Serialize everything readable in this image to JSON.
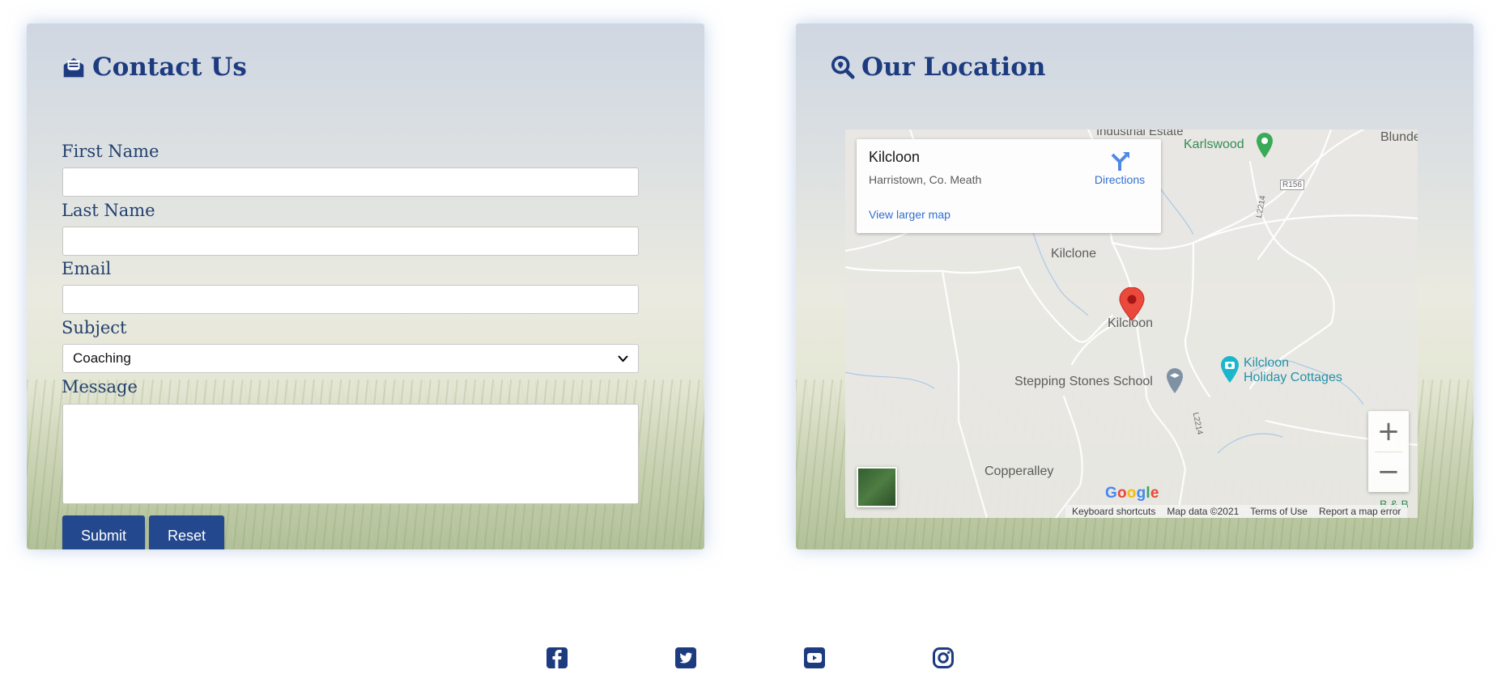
{
  "contact": {
    "title": "Contact Us",
    "title_icon": "envelope-open-text-icon",
    "fields": {
      "first_name": {
        "label": "First Name",
        "value": ""
      },
      "last_name": {
        "label": "Last Name",
        "value": ""
      },
      "email": {
        "label": "Email",
        "value": ""
      },
      "subject": {
        "label": "Subject",
        "value": "Coaching"
      },
      "message": {
        "label": "Message",
        "value": ""
      }
    },
    "buttons": {
      "submit": "Submit",
      "reset": "Reset"
    }
  },
  "location": {
    "title": "Our Location",
    "title_icon": "search-location-icon",
    "map": {
      "info_card": {
        "place": "Kilcloon",
        "address": "Harristown, Co. Meath",
        "directions": "Directions",
        "larger_map": "View larger map"
      },
      "labels": {
        "industrial": "Industrial Estate",
        "karlswood": "Karlswood",
        "blunde": "Blunde",
        "r156": "R156",
        "l2214_top": "L2214",
        "l2214_bottom": "L2214",
        "kilclone": "Kilclone",
        "kilcloon_pin": "Kilcloon",
        "stepping_stones": "Stepping Stones School",
        "holiday_cottages_1": "Kilcloon",
        "holiday_cottages_2": "Holiday Cottages",
        "copperalley": "Copperalley",
        "bb": "B & B"
      },
      "zoom_in": "+",
      "zoom_out": "−",
      "google": [
        "G",
        "o",
        "o",
        "g",
        "l",
        "e"
      ],
      "google_colors": [
        "#4285F4",
        "#EA4335",
        "#FBBC05",
        "#4285F4",
        "#34A853",
        "#EA4335"
      ],
      "attribution": {
        "shortcuts": "Keyboard shortcuts",
        "data": "Map data ©2021",
        "terms": "Terms of Use",
        "report": "Report a map error"
      }
    }
  },
  "social": [
    "facebook-square-icon",
    "twitter-square-icon",
    "youtube-square-icon",
    "instagram-icon"
  ],
  "colors": {
    "brand": "#23488d",
    "title": "#1d3c80"
  }
}
